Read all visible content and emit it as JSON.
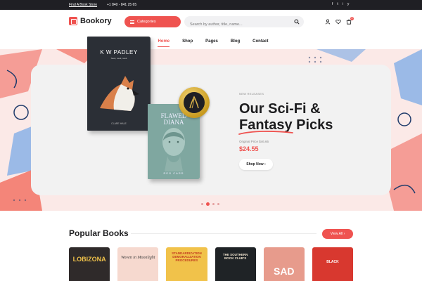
{
  "topbar": {
    "find_store": "Find A Book Store",
    "phone": "+1 840 - 841 25 65",
    "social": [
      "f",
      "t",
      "i",
      "y"
    ]
  },
  "header": {
    "brand": "Bookory",
    "categories_label": "Categories",
    "search_placeholder": "Search by author, title, name...",
    "cart_count": "0"
  },
  "nav": {
    "items": [
      "Home",
      "Shop",
      "Pages",
      "Blog",
      "Contact"
    ],
    "active": "Home"
  },
  "hero": {
    "eyebrow": "NEW RELEASES",
    "title_line1": "Our Sci-Fi &",
    "title_highlight": "Fantasy",
    "title_line2_rest": "Picks",
    "original_price_label": "Original Price $46.66",
    "price": "$24.55",
    "shop_button": "Shop Now",
    "book1_title": "K W PADLEY",
    "book1_sub": "Seek, seek, seek",
    "book1_author": "CLARE HALE",
    "book2_title1": "FLAWED",
    "book2_title2": "DIANA",
    "book2_author": "REG CARR",
    "slides": 4,
    "active_slide": 2
  },
  "popular": {
    "title": "Popular Books",
    "view_all": "View All",
    "books": [
      {
        "label": "LOBIZONA",
        "bg": "#2f2a2a",
        "fg": "#f0c24a"
      },
      {
        "label": "Woven in Moonlight",
        "bg": "#f6d9cf",
        "fg": "#3a3a3a"
      },
      {
        "label": "STANDARDIZATION DEMORALIZATION PROCEDURES",
        "bg": "#f1c24a",
        "fg": "#c23a1f"
      },
      {
        "label": "THE SOUTHERN BOOK CLUB'S",
        "bg": "#1f2326",
        "fg": "#f0e4cf"
      },
      {
        "label": "SAD",
        "bg": "#e79b8c",
        "fg": "#ffffff"
      },
      {
        "label": "BLACK",
        "bg": "#d8382f",
        "fg": "#ffffff"
      }
    ]
  },
  "colors": {
    "accent": "#ef5350",
    "dark": "#1f1f24"
  }
}
